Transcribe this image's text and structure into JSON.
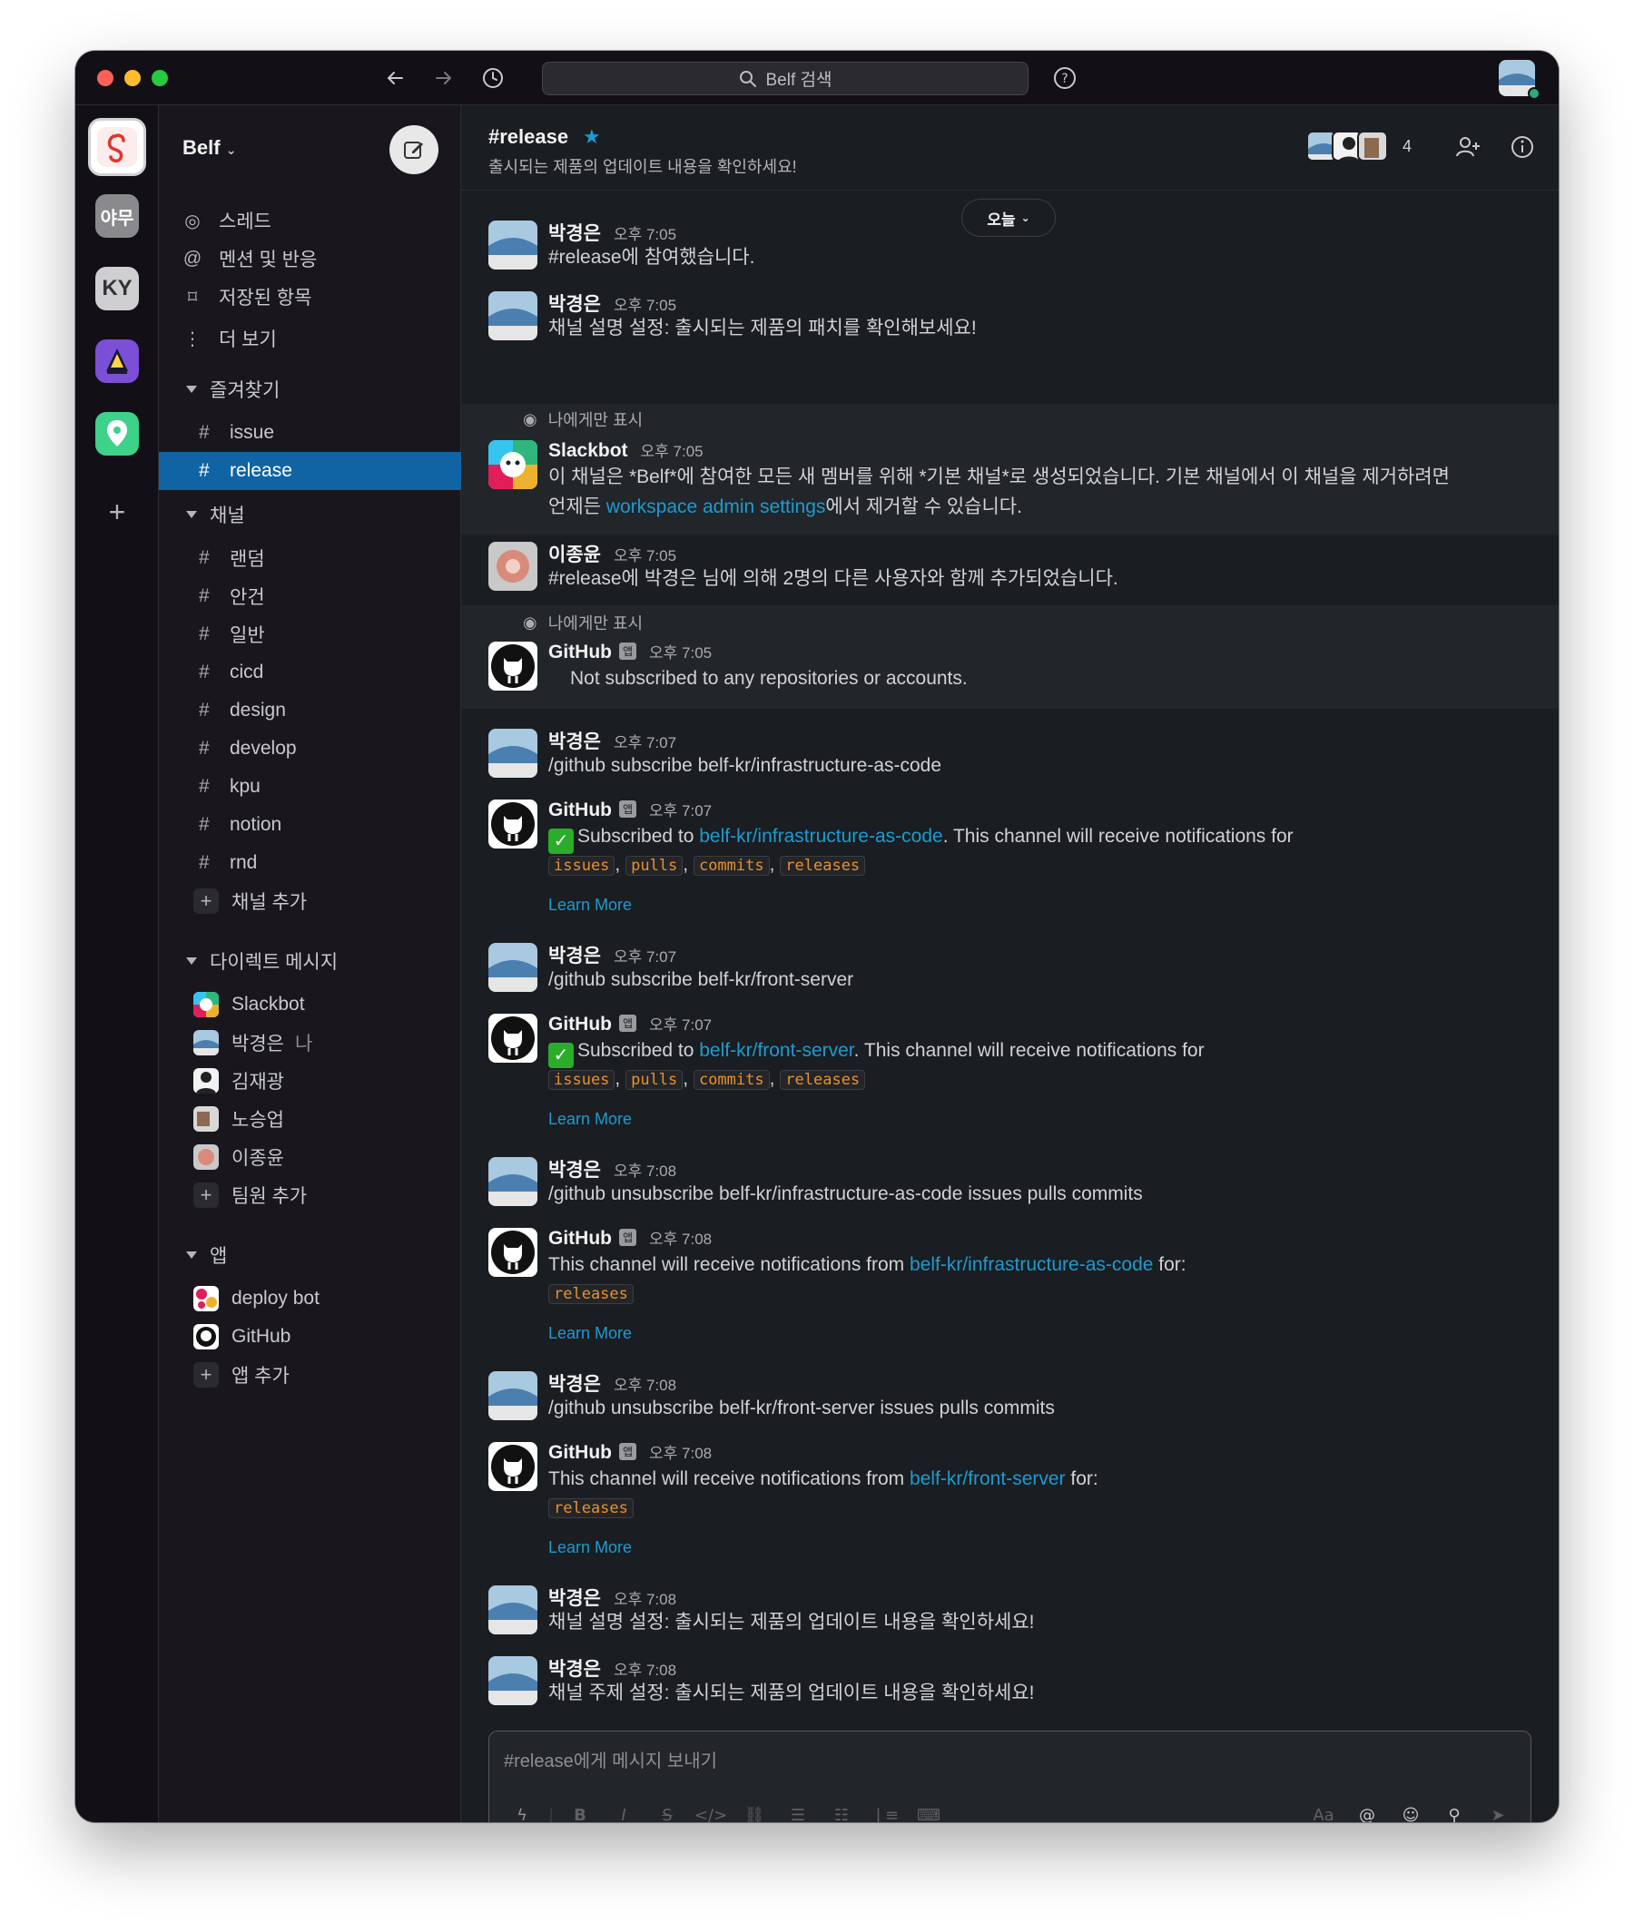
{
  "search": {
    "placeholder": "Belf 검색"
  },
  "workspace": {
    "name": "Belf",
    "rail": [
      {
        "label": ""
      },
      {
        "label": "야무"
      },
      {
        "label": "KY"
      },
      {
        "label": ""
      },
      {
        "label": ""
      }
    ]
  },
  "sidebar": {
    "nav": [
      {
        "icon": "threads-icon",
        "label": "스레드"
      },
      {
        "icon": "mentions-icon",
        "label": "멘션 및 반응"
      },
      {
        "icon": "bookmark-icon",
        "label": "저장된 항목"
      },
      {
        "icon": "more-icon",
        "label": "더 보기"
      }
    ],
    "favorites_label": "즐겨찾기",
    "favorites": [
      {
        "label": "issue"
      },
      {
        "label": "release"
      }
    ],
    "channels_label": "채널",
    "channels": [
      {
        "label": "랜덤"
      },
      {
        "label": "안건"
      },
      {
        "label": "일반"
      },
      {
        "label": "cicd"
      },
      {
        "label": "design"
      },
      {
        "label": "develop"
      },
      {
        "label": "kpu"
      },
      {
        "label": "notion"
      },
      {
        "label": "rnd"
      }
    ],
    "add_channel": "채널 추가",
    "dm_label": "다이렉트 메시지",
    "dms": [
      {
        "label": "Slackbot"
      },
      {
        "label": "박경은",
        "me": "나"
      },
      {
        "label": "김재광"
      },
      {
        "label": "노승업"
      },
      {
        "label": "이종윤"
      }
    ],
    "add_member": "팀원 추가",
    "apps_label": "앱",
    "apps": [
      {
        "label": "deploy bot"
      },
      {
        "label": "GitHub"
      }
    ],
    "add_app": "앱 추가"
  },
  "channel": {
    "name": "#release",
    "topic": "출시되는 제품의 업데이트 내용을 확인하세요!",
    "member_count": "4",
    "date_divider": "오늘"
  },
  "messages": [
    {
      "sender": "박경은",
      "time": "오후 7:05",
      "text": "#release에 참여했습니다."
    },
    {
      "sender": "박경은",
      "time": "오후 7:05",
      "text": "채널 설명 설정: 출시되는 제품의 패치를 확인해보세요!"
    },
    {
      "only_you": "나에게만 표시",
      "sender": "Slackbot",
      "time": "오후 7:05",
      "text_a": "이 채널은 *Belf*에 참여한 모든 새 멤버를 위해 *기본 채널*로 생성되었습니다. 기본 채널에서 이 채널을 제거하려면",
      "text_b_pre": "언제든 ",
      "text_b_link": "workspace admin settings",
      "text_b_post": "에서 제거할 수 있습니다."
    },
    {
      "sender": "이종윤",
      "time": "오후 7:05",
      "text": "#release에 박경은 님에 의해 2명의 다른 사용자와 함께 추가되었습니다."
    },
    {
      "only_you": "나에게만 표시",
      "sender": "GitHub",
      "badge": "앱",
      "time": "오후 7:05",
      "text": "Not subscribed to any repositories or accounts."
    },
    {
      "sender": "박경은",
      "time": "오후 7:07",
      "text": "/github subscribe belf-kr/infrastructure-as-code"
    },
    {
      "sender": "GitHub",
      "badge": "앱",
      "time": "오후 7:07",
      "pre": "Subscribed to ",
      "link": "belf-kr/infrastructure-as-code",
      "post": ". This channel will receive notifications for",
      "codes": [
        "issues",
        "pulls",
        "commits",
        "releases"
      ],
      "learn": "Learn More"
    },
    {
      "sender": "박경은",
      "time": "오후 7:07",
      "text": "/github subscribe belf-kr/front-server"
    },
    {
      "sender": "GitHub",
      "badge": "앱",
      "time": "오후 7:07",
      "pre": "Subscribed to ",
      "link": "belf-kr/front-server",
      "post": ". This channel will receive notifications for",
      "codes": [
        "issues",
        "pulls",
        "commits",
        "releases"
      ],
      "learn": "Learn More"
    },
    {
      "sender": "박경은",
      "time": "오후 7:08",
      "text": "/github unsubscribe belf-kr/infrastructure-as-code issues pulls commits"
    },
    {
      "sender": "GitHub",
      "badge": "앱",
      "time": "오후 7:08",
      "pre": "This channel will receive notifications from ",
      "link": "belf-kr/infrastructure-as-code",
      "post": " for:",
      "codes": [
        "releases"
      ],
      "learn": "Learn More"
    },
    {
      "sender": "박경은",
      "time": "오후 7:08",
      "text": "/github unsubscribe belf-kr/front-server issues pulls commits"
    },
    {
      "sender": "GitHub",
      "badge": "앱",
      "time": "오후 7:08",
      "pre": "This channel will receive notifications from ",
      "link": "belf-kr/front-server",
      "post": " for:",
      "codes": [
        "releases"
      ],
      "learn": "Learn More"
    },
    {
      "sender": "박경은",
      "time": "오후 7:08",
      "text": "채널 설명 설정: 출시되는 제품의 업데이트 내용을 확인하세요!"
    },
    {
      "sender": "박경은",
      "time": "오후 7:08",
      "text": "채널 주제 설정: 출시되는 제품의 업데이트 내용을 확인하세요!"
    }
  ],
  "composer": {
    "placeholder": "#release에게 메시지 보내기"
  },
  "colors": {
    "accent": "#1164a3",
    "link": "#1d9bd1",
    "code": "#e8912d",
    "online": "#2bac76"
  }
}
